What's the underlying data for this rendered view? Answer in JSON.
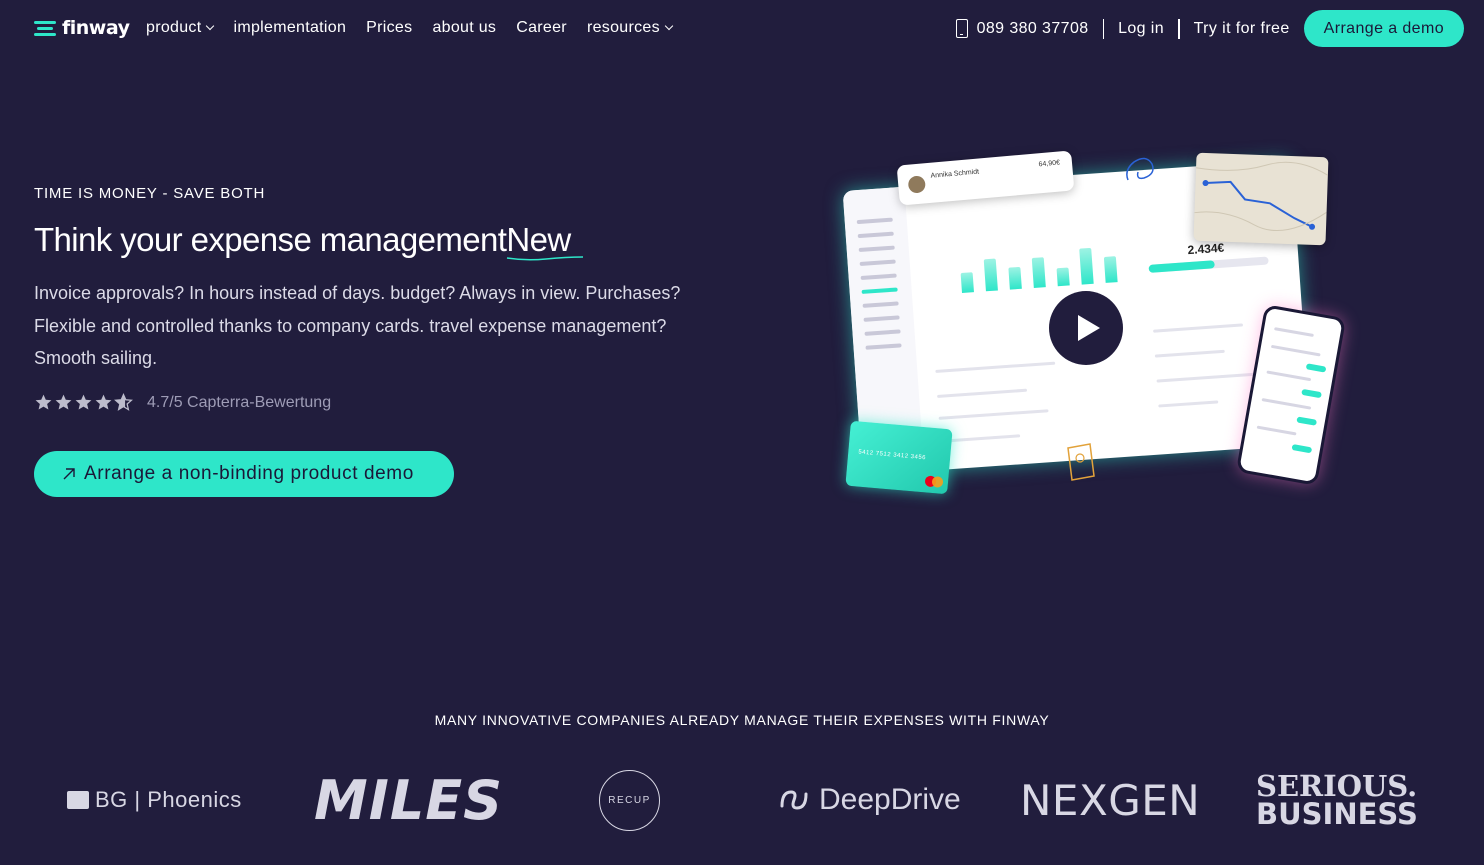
{
  "nav": {
    "logo_text": "finway",
    "menu": [
      {
        "label": "product",
        "dropdown": true
      },
      {
        "label": "implementation",
        "dropdown": false
      },
      {
        "label": "Prices",
        "dropdown": false
      },
      {
        "label": "about us",
        "dropdown": false
      },
      {
        "label": "Career",
        "dropdown": false
      },
      {
        "label": "resources",
        "dropdown": true
      }
    ],
    "phone": "089 380 37708",
    "login": "Log in",
    "try_free": "Try it for free",
    "demo_button": "Arrange a demo"
  },
  "hero": {
    "eyebrow": "TIME IS MONEY - SAVE BOTH",
    "headline": "Think your expense management",
    "headline_accent": "New",
    "description": "Invoice approvals? In hours instead of days. budget? Always in view. Purchases? Flexible and controlled thanks to company cards. travel expense management? Smooth sailing.",
    "rating_value": 4.7,
    "rating_max": 5,
    "rating_text": "4.7/5 Capterra-Bewertung",
    "cta": "Arrange a non-binding product demo"
  },
  "illustration": {
    "card_name": "Annika Schmidt",
    "card_amount": "64,90€",
    "budget_value": "2.434€",
    "card_number": "5412 7512 3412 3456"
  },
  "trust": {
    "heading": "MANY INNOVATIVE COMPANIES ALREADY MANAGE THEIR EXPENSES WITH FINWAY",
    "logos": [
      "BG | Phoenics",
      "MILES",
      "RECUP",
      "DeepDrive",
      "NEXGEN",
      "SERIOUS.",
      "BUSINESS"
    ]
  },
  "colors": {
    "background": "#211d3d",
    "accent": "#2ee6c9"
  }
}
